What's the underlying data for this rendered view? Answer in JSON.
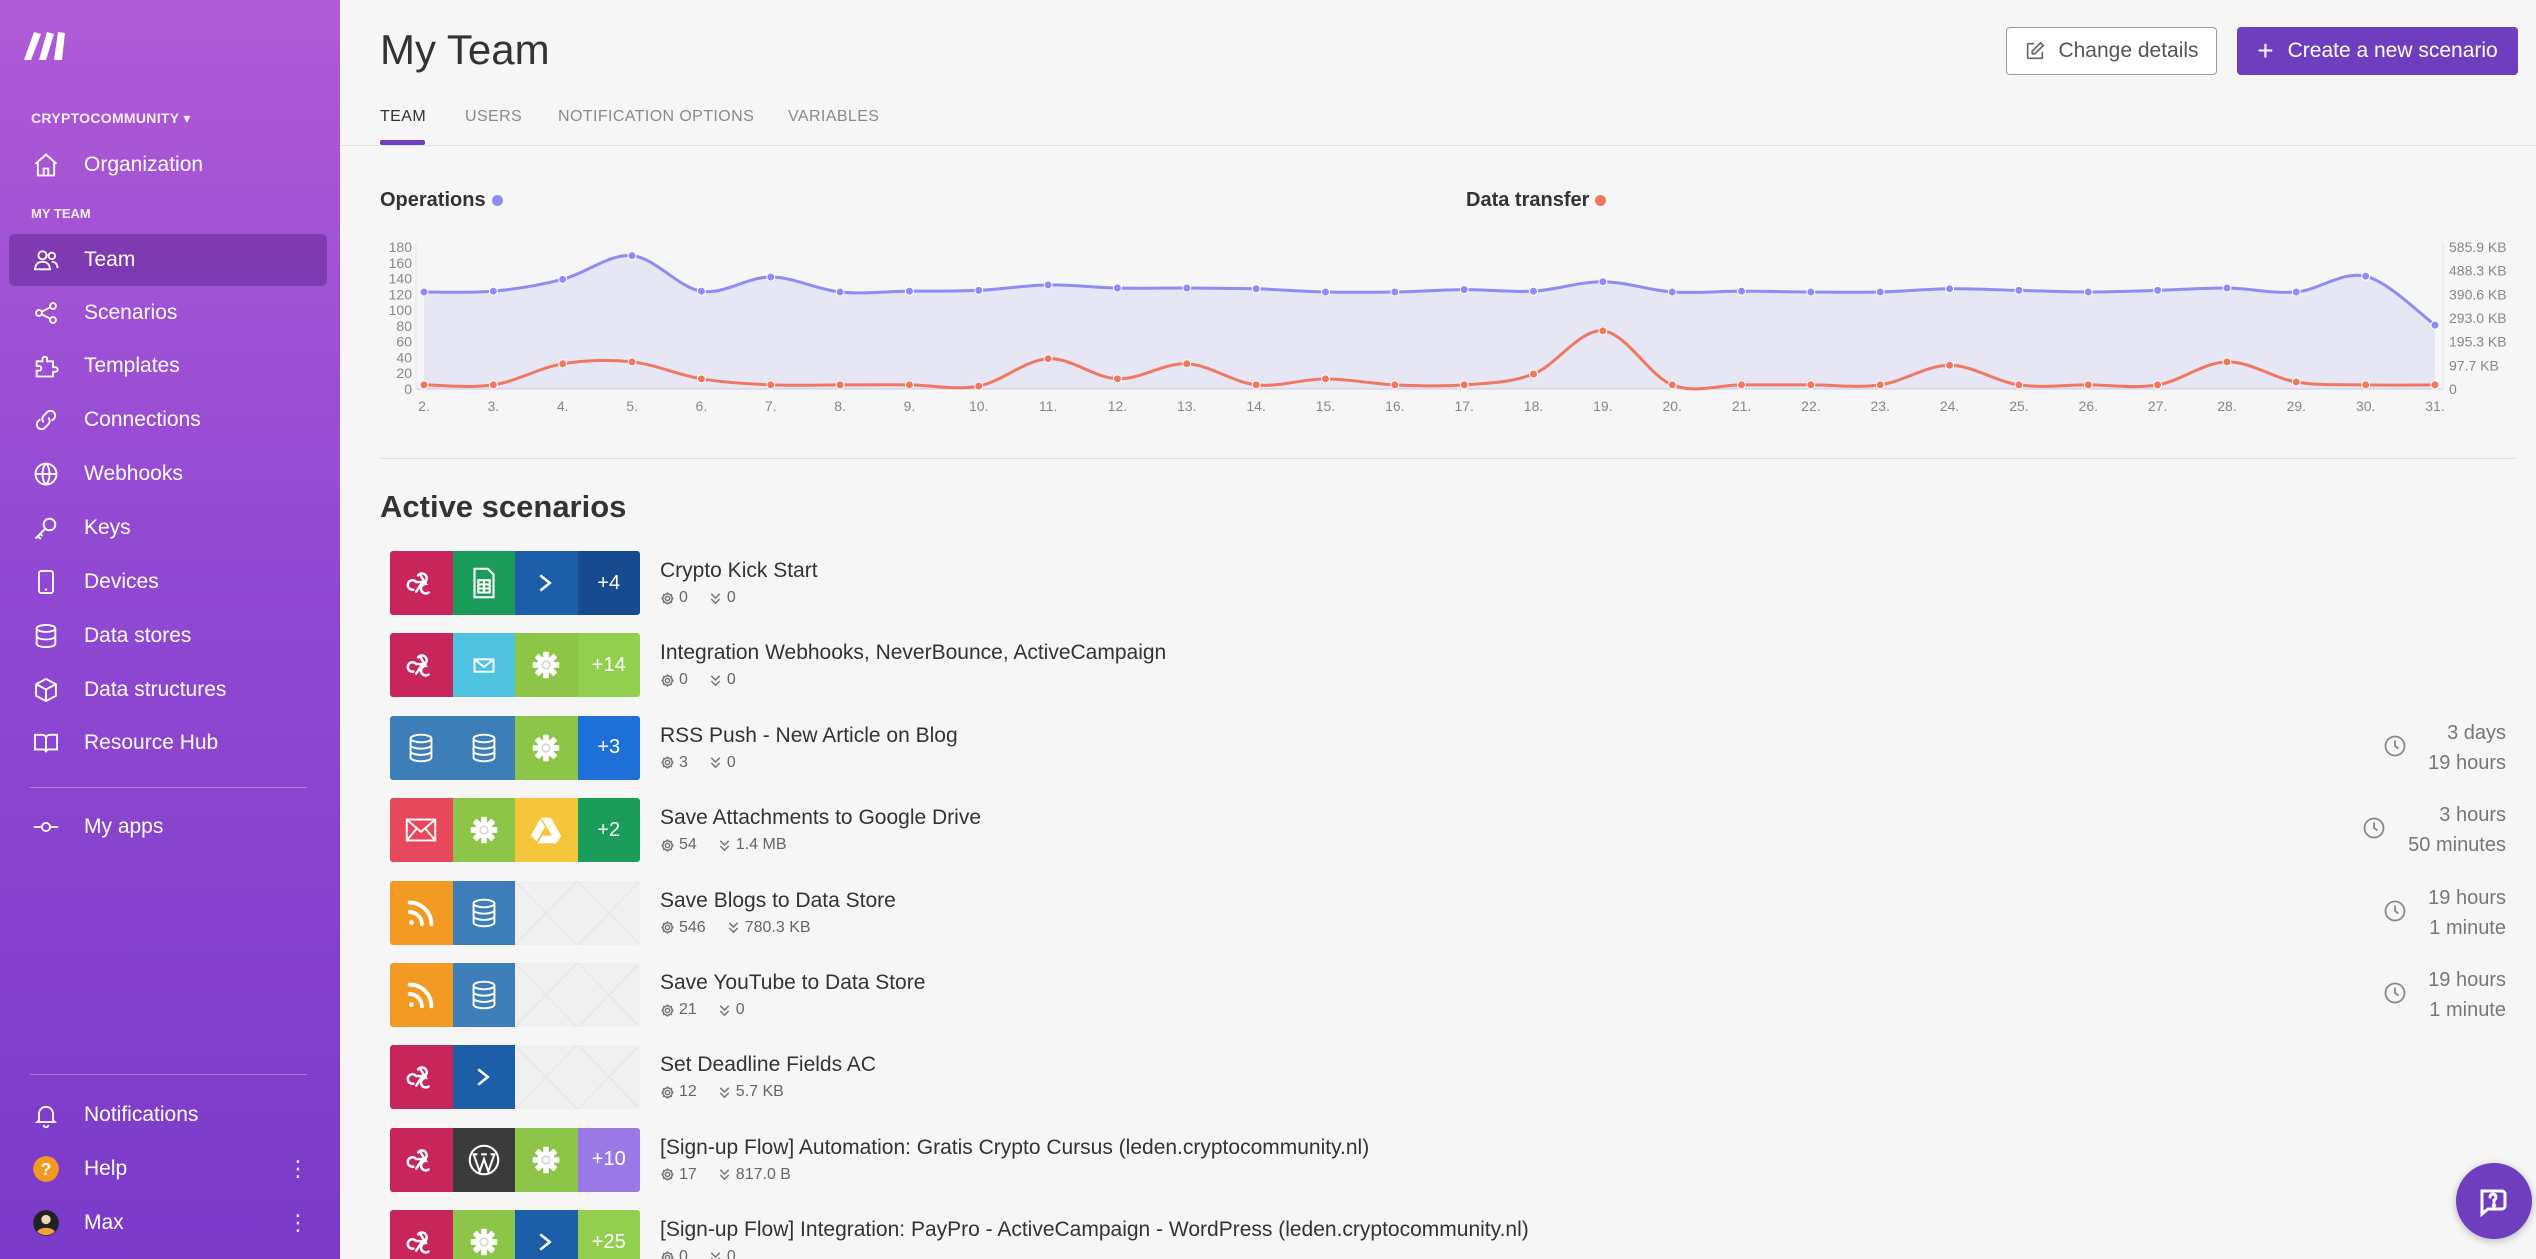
{
  "colors": {
    "accent": "#6f3ebe",
    "operations": "#8f8cf2",
    "data_transfer": "#f07860",
    "sidebar_top": "#b05ad6",
    "sidebar_bottom": "#7b3ac9"
  },
  "sidebar": {
    "org_name": "CRYPTOCOMMUNITY",
    "org_section_label": "MY TEAM",
    "items": [
      {
        "label": "Organization",
        "icon": "home-icon"
      },
      {
        "label": "Team",
        "icon": "users-icon"
      },
      {
        "label": "Scenarios",
        "icon": "share-icon"
      },
      {
        "label": "Templates",
        "icon": "puzzle-icon"
      },
      {
        "label": "Connections",
        "icon": "link-icon"
      },
      {
        "label": "Webhooks",
        "icon": "globe-icon"
      },
      {
        "label": "Keys",
        "icon": "key-icon"
      },
      {
        "label": "Devices",
        "icon": "phone-icon"
      },
      {
        "label": "Data stores",
        "icon": "database-icon"
      },
      {
        "label": "Data structures",
        "icon": "cube-icon"
      },
      {
        "label": "Resource Hub",
        "icon": "book-icon"
      },
      {
        "label": "My apps",
        "icon": "commit-icon"
      }
    ],
    "bottom": [
      {
        "label": "Notifications",
        "icon": "bell-icon"
      },
      {
        "label": "Help",
        "icon": "help-icon"
      },
      {
        "label": "Max",
        "icon": "avatar"
      }
    ]
  },
  "header": {
    "title": "My Team",
    "change_details": "Change details",
    "create_scenario": "Create a new scenario",
    "tabs": [
      "TEAM",
      "USERS",
      "NOTIFICATION OPTIONS",
      "VARIABLES"
    ],
    "active_tab": "TEAM"
  },
  "chart_data": {
    "type": "line",
    "title": "",
    "legend": [
      "Operations",
      "Data transfer"
    ],
    "x": [
      "2.",
      "3.",
      "4.",
      "5.",
      "6.",
      "7.",
      "8.",
      "9.",
      "10.",
      "11.",
      "12.",
      "13.",
      "14.",
      "15.",
      "16.",
      "17.",
      "18.",
      "19.",
      "20.",
      "21.",
      "22.",
      "23.",
      "24.",
      "25.",
      "26.",
      "27.",
      "28.",
      "29.",
      "30.",
      "31."
    ],
    "series": [
      {
        "name": "Operations",
        "axis": "left",
        "values": [
          123,
          124,
          139,
          169,
          124,
          142,
          123,
          124,
          125,
          132,
          128,
          128,
          127,
          123,
          123,
          126,
          124,
          136,
          123,
          124,
          123,
          123,
          127,
          125,
          123,
          125,
          128,
          123,
          143,
          81
        ]
      },
      {
        "name": "Data transfer",
        "axis": "right",
        "unit": "KB",
        "values": [
          17,
          17,
          104,
          112,
          42,
          17,
          17,
          17,
          12,
          125,
          42,
          104,
          17,
          42,
          17,
          17,
          62,
          240,
          17,
          17,
          17,
          17,
          98,
          17,
          17,
          17,
          112,
          29,
          17,
          17
        ]
      }
    ],
    "y_left": {
      "ticks": [
        0,
        20,
        40,
        60,
        80,
        100,
        120,
        140,
        160,
        180
      ],
      "ylim": [
        0,
        180
      ]
    },
    "y_right": {
      "ticks": [
        "0",
        "97.7 KB",
        "195.3 KB",
        "293.0 KB",
        "390.6 KB",
        "488.3 KB",
        "585.9 KB"
      ],
      "ylim": [
        0,
        585.9
      ]
    },
    "legend_placement": "top",
    "grid": false,
    "area_fill": true
  },
  "scenarios_heading": "Active scenarios",
  "scenarios": [
    {
      "name": "Crypto Kick Start",
      "ops": "0",
      "transfer": "0",
      "time1": "",
      "time2": "",
      "tiles": [
        {
          "icon": "webhook-icon",
          "color": "#c8265a"
        },
        {
          "icon": "sheets-icon",
          "color": "#1b9c5a"
        },
        {
          "icon": "chevron-right-icon",
          "color": "#1c5fa8"
        },
        {
          "text": "+4",
          "color": "#184a8f"
        }
      ]
    },
    {
      "name": "Integration Webhooks, NeverBounce, ActiveCampaign",
      "ops": "0",
      "transfer": "0",
      "time1": "",
      "time2": "",
      "tiles": [
        {
          "icon": "webhook-icon",
          "color": "#c8265a"
        },
        {
          "icon": "email-icon",
          "color": "#4fc2e0"
        },
        {
          "icon": "gear-icon",
          "color": "#8cc548"
        },
        {
          "text": "+14",
          "color": "#93cf4f"
        }
      ]
    },
    {
      "name": "RSS Push - New Article on Blog",
      "ops": "3",
      "transfer": "0",
      "time1": "3 days",
      "time2": "19 hours",
      "tiles": [
        {
          "icon": "database-icon",
          "color": "#3d7eb8"
        },
        {
          "icon": "database-icon",
          "color": "#3d7eb8"
        },
        {
          "icon": "gear-icon",
          "color": "#8cc548"
        },
        {
          "text": "+3",
          "color": "#1f6fd8"
        }
      ]
    },
    {
      "name": "Save Attachments to Google Drive",
      "ops": "54",
      "transfer": "1.4 MB",
      "time1": "3 hours",
      "time2": "50 minutes",
      "tiles": [
        {
          "icon": "mail-icon",
          "color": "#e8485c"
        },
        {
          "icon": "gear-icon",
          "color": "#8cc548"
        },
        {
          "icon": "drive-icon",
          "color": "#f5c53b"
        },
        {
          "text": "+2",
          "color": "#1b9c5a"
        }
      ]
    },
    {
      "name": "Save Blogs to Data Store",
      "ops": "546",
      "transfer": "780.3 KB",
      "time1": "19 hours",
      "time2": "1 minute",
      "tiles": [
        {
          "icon": "rss-icon",
          "color": "#f39a24"
        },
        {
          "icon": "database-icon",
          "color": "#3d7eb8"
        },
        {
          "icon": "empty"
        },
        {
          "icon": "empty"
        }
      ]
    },
    {
      "name": "Save YouTube to Data Store",
      "ops": "21",
      "transfer": "0",
      "time1": "19 hours",
      "time2": "1 minute",
      "tiles": [
        {
          "icon": "rss-icon",
          "color": "#f39a24"
        },
        {
          "icon": "database-icon",
          "color": "#3d7eb8"
        },
        {
          "icon": "empty"
        },
        {
          "icon": "empty"
        }
      ]
    },
    {
      "name": "Set Deadline Fields AC",
      "ops": "12",
      "transfer": "5.7 KB",
      "time1": "",
      "time2": "",
      "tiles": [
        {
          "icon": "webhook-icon",
          "color": "#c8265a"
        },
        {
          "icon": "chevron-right-icon",
          "color": "#1c5fa8"
        },
        {
          "icon": "empty"
        },
        {
          "icon": "empty"
        }
      ]
    },
    {
      "name": "[Sign-up Flow] Automation: Gratis Crypto Cursus (leden.cryptocommunity.nl)",
      "ops": "17",
      "transfer": "817.0 B",
      "time1": "",
      "time2": "",
      "tiles": [
        {
          "icon": "webhook-icon",
          "color": "#c8265a"
        },
        {
          "icon": "wordpress-icon",
          "color": "#3b3b3b"
        },
        {
          "icon": "gear-icon",
          "color": "#8cc548"
        },
        {
          "text": "+10",
          "color": "#9a78e6"
        }
      ]
    },
    {
      "name": "[Sign-up Flow] Integration: PayPro - ActiveCampaign - WordPress (leden.cryptocommunity.nl)",
      "ops": "0",
      "transfer": "0",
      "time1": "",
      "time2": "",
      "tiles": [
        {
          "icon": "webhook-icon",
          "color": "#c8265a"
        },
        {
          "icon": "gear-icon",
          "color": "#8cc548"
        },
        {
          "icon": "chevron-right-icon",
          "color": "#1c5fa8"
        },
        {
          "text": "+25",
          "color": "#93cf4f"
        }
      ]
    }
  ]
}
